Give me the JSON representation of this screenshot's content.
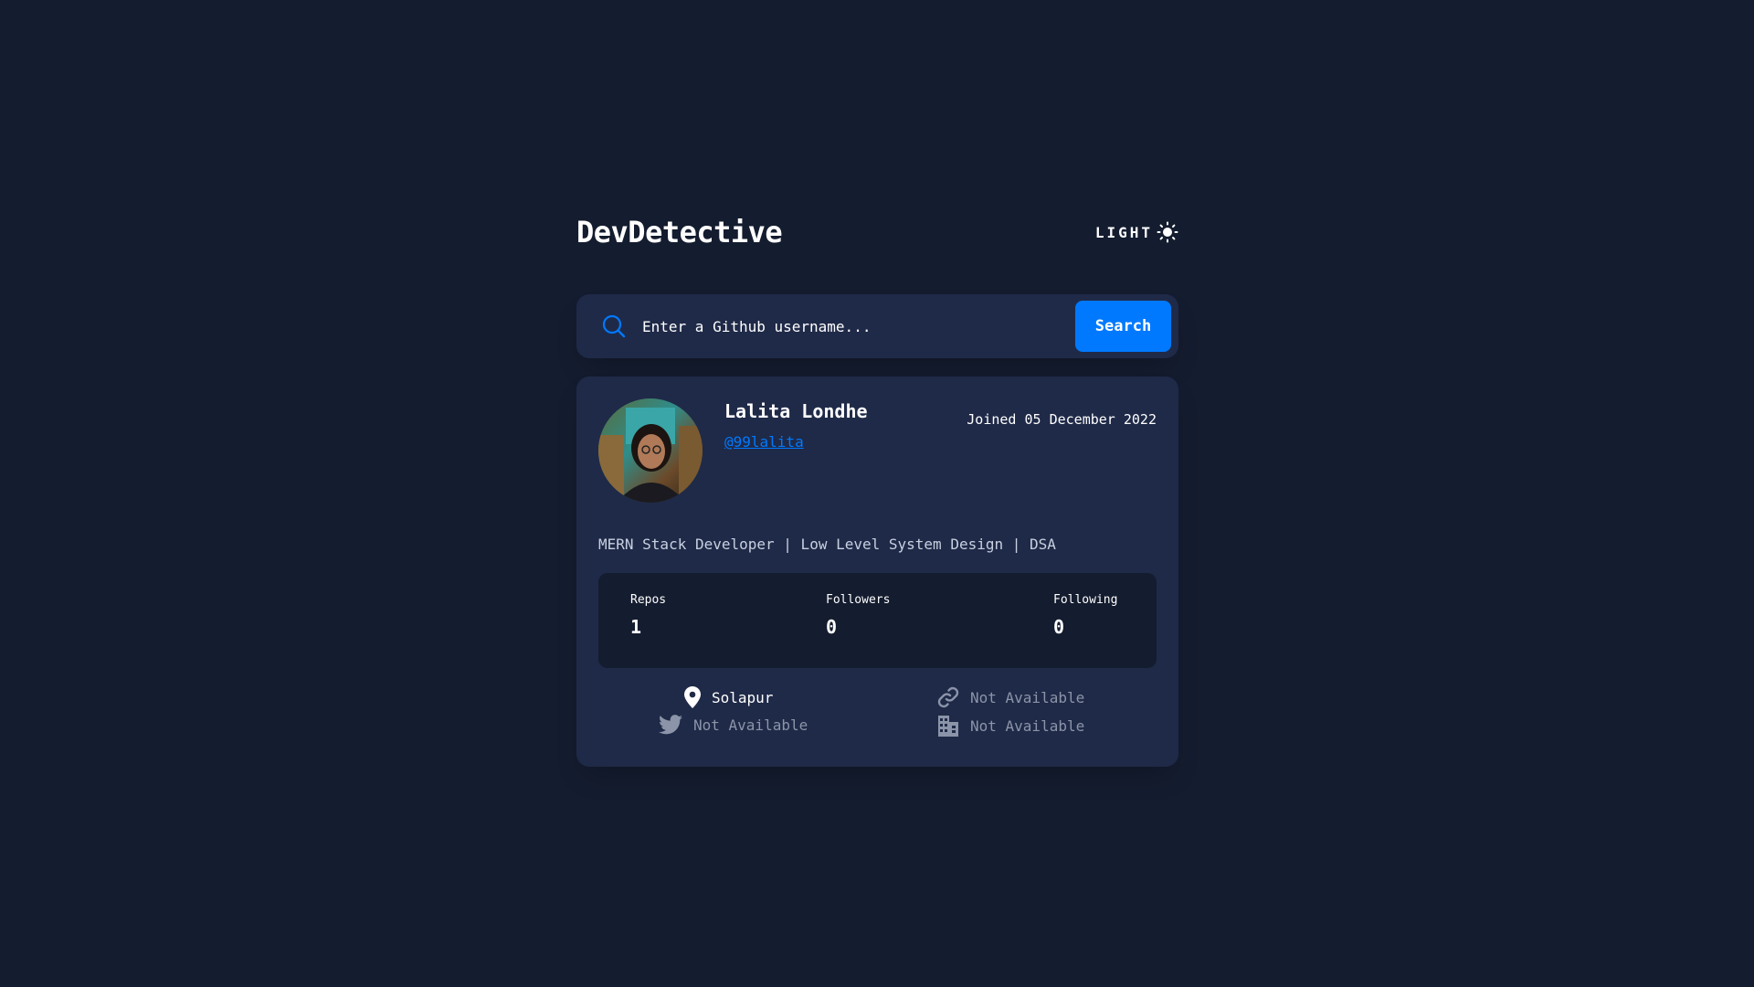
{
  "header": {
    "title": "DevDetective",
    "mode_label": "LIGHT",
    "mode_icon": "sun-icon"
  },
  "search": {
    "placeholder": "Enter a Github username...",
    "button_label": "Search",
    "icon": "search-icon"
  },
  "profile": {
    "name": "Lalita Londhe",
    "handle": "@99lalita",
    "joined": "Joined 05 December 2022",
    "bio": "MERN Stack Developer | Low Level System Design | DSA",
    "stats": [
      {
        "label": "Repos",
        "value": "1"
      },
      {
        "label": "Followers",
        "value": "0"
      },
      {
        "label": "Following",
        "value": "0"
      }
    ],
    "links": {
      "location": {
        "icon": "location-pin-icon",
        "text": "Solapur"
      },
      "website": {
        "icon": "link-icon",
        "text": "Not Available"
      },
      "twitter": {
        "icon": "twitter-icon",
        "text": "Not Available"
      },
      "company": {
        "icon": "building-icon",
        "text": "Not Available"
      }
    }
  },
  "colors": {
    "background": "#141c2f",
    "card": "#1f2a48",
    "accent": "#0079ff",
    "muted": "#8b94a8"
  }
}
